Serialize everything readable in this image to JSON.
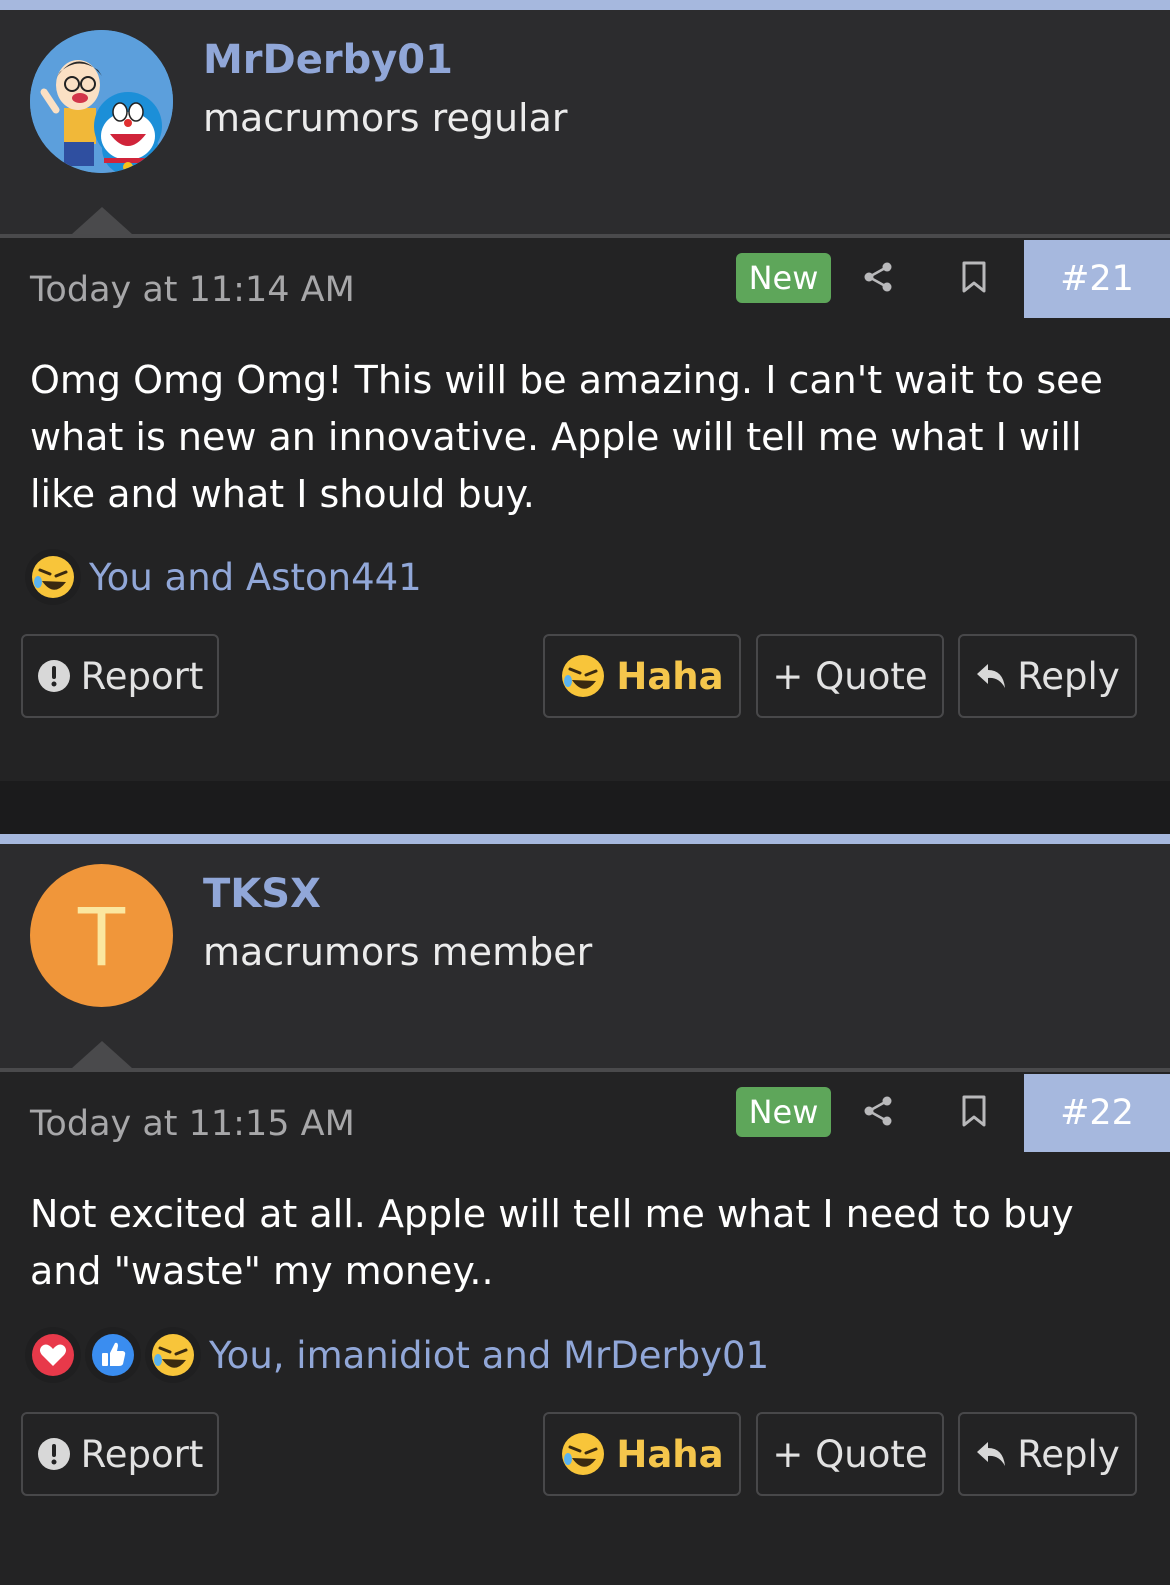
{
  "colors": {
    "accent": "#a6b8de",
    "username": "#91a7d8",
    "new_badge": "#5ea65a",
    "haha": "#f5c64c",
    "avatar_tksx": "#f0963a"
  },
  "posts": [
    {
      "username": "MrDerby01",
      "user_title": "macrumors regular",
      "avatar": "cartoon-avatar",
      "timestamp": "Today at 11:14 AM",
      "new_badge": "New",
      "post_number": "#21",
      "message": "Omg Omg Omg! This will be amazing. I can't wait to see what is new an innovative. Apple will tell me what I will like and what I should buy.",
      "reactions": [
        "laughing-emoji-icon"
      ],
      "reaction_users": "You and Aston441",
      "buttons": {
        "report": "Report",
        "haha": "Haha",
        "quote": "+ Quote",
        "reply": "Reply"
      }
    },
    {
      "username": "TKSX",
      "user_title": "macrumors member",
      "avatar_letter": "T",
      "timestamp": "Today at 11:15 AM",
      "new_badge": "New",
      "post_number": "#22",
      "message": "Not excited at all. Apple will tell me what I need to buy and \"waste\" my money..",
      "reactions": [
        "heart-icon",
        "thumbs-up-icon",
        "laughing-emoji-icon"
      ],
      "reaction_users": "You, imanidiot and MrDerby01",
      "buttons": {
        "report": "Report",
        "haha": "Haha",
        "quote": "+ Quote",
        "reply": "Reply"
      }
    }
  ]
}
